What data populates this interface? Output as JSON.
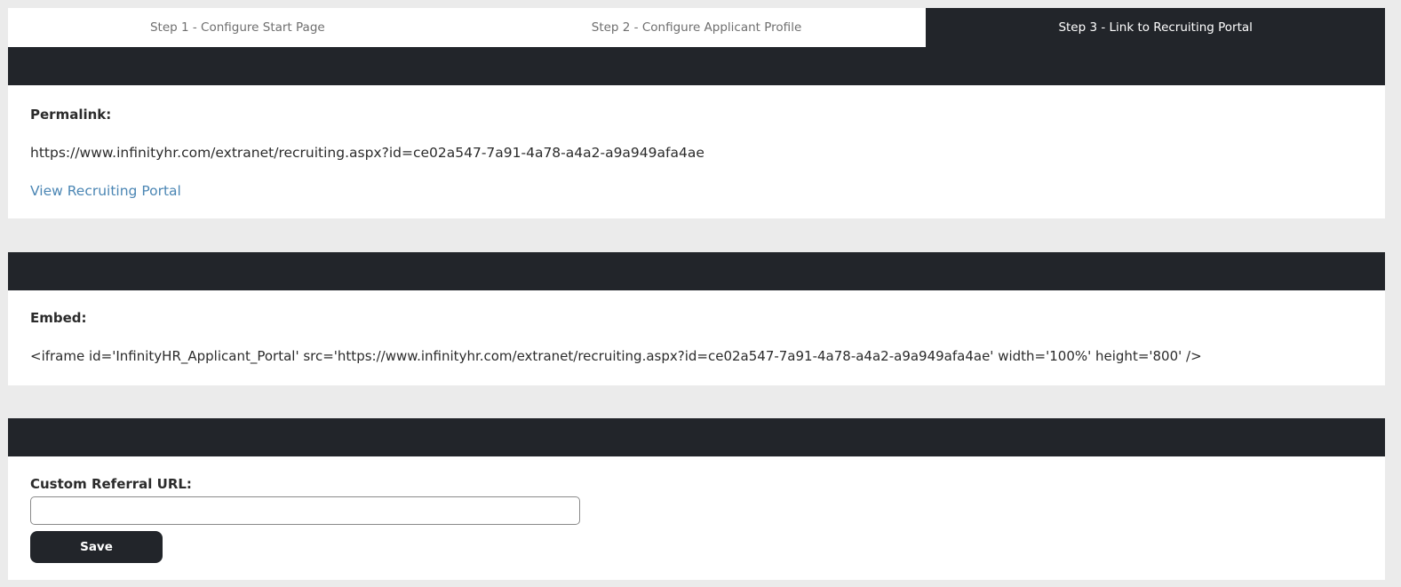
{
  "tabs": [
    {
      "label": "Step 1 - Configure Start Page"
    },
    {
      "label": "Step 2 - Configure Applicant Profile"
    },
    {
      "label": "Step 3 - Link to Recruiting Portal"
    }
  ],
  "permalink": {
    "label": "Permalink:",
    "url": "https://www.infinityhr.com/extranet/recruiting.aspx?id=ce02a547-7a91-4a78-a4a2-a9a949afa4ae",
    "view_link": "View Recruiting Portal"
  },
  "embed": {
    "label": "Embed:",
    "code": "<iframe id='InfinityHR_Applicant_Portal' src='https://www.infinityhr.com/extranet/recruiting.aspx?id=ce02a547-7a91-4a78-a4a2-a9a949afa4ae' width='100%' height='800' />"
  },
  "referral": {
    "label": "Custom Referral URL:",
    "value": "",
    "save_label": "Save"
  },
  "colors": {
    "dark": "#22252a",
    "link": "#4b86b4",
    "background": "#ebebeb"
  }
}
